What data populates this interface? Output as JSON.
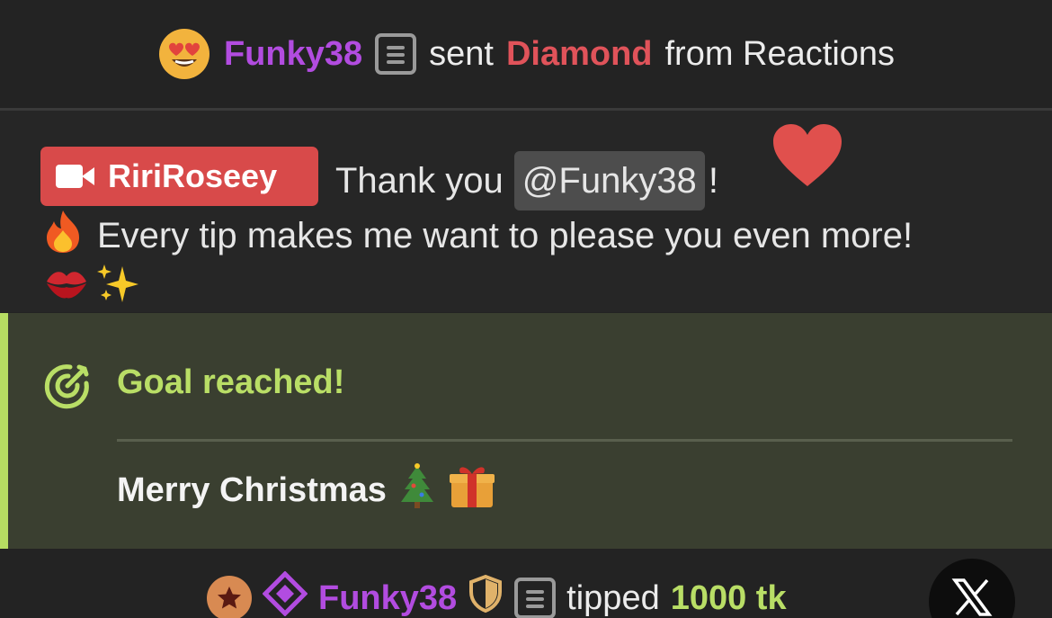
{
  "top_notice": {
    "user": "Funky38",
    "sent_text": "sent",
    "item": "Diamond",
    "from_text": "from Reactions",
    "emoji_icon": "heart-eyes-emoji-icon"
  },
  "message": {
    "author": "RiriRoseey",
    "text_before": "Thank you",
    "mention": "@Funky38",
    "text_after": "!",
    "line2": "Every tip makes me want to please you even more!",
    "badge_color": "#d84a4a"
  },
  "goal": {
    "title": "Goal reached!",
    "description": "Merry Christmas",
    "accent": "#b6dd62"
  },
  "tip_row": {
    "user": "Funky38",
    "action": "tipped",
    "amount": "1000 tk"
  },
  "colors": {
    "user_purple": "#b24ce0",
    "diamond_red": "#e0535a",
    "goal_green": "#b9de66"
  }
}
